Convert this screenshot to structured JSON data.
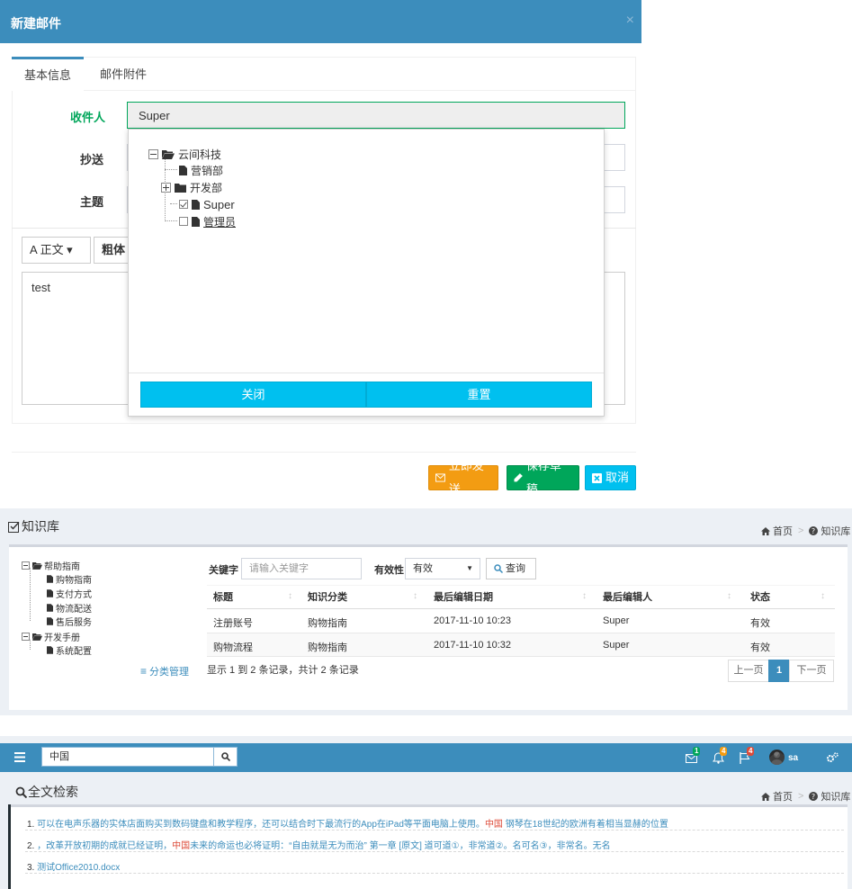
{
  "modal": {
    "title": "新建邮件",
    "close_symbol": "×",
    "tabs": [
      "基本信息",
      "邮件附件"
    ],
    "fields": {
      "to_label": "收件人",
      "to_value": "Super",
      "cc_label": "抄送",
      "subject_label": "主题"
    },
    "toolbar": {
      "format_label": "A 正文 ▾",
      "bold_label": "粗体"
    },
    "body_text": "test",
    "tree": {
      "root": "云间科技",
      "items": [
        "营销部",
        "开发部",
        "Super",
        "管理员"
      ]
    },
    "dropdown_buttons": {
      "close": "关闭",
      "reset": "重置"
    },
    "actions": {
      "send": "立即发送",
      "draft": "保存草稿",
      "cancel": "取消"
    },
    "colors": {
      "header": "#3c8dbc",
      "send": "#f39c12",
      "draft": "#00a65a",
      "cancel": "#00c0ef",
      "dropdown_btn": "#00c0ef"
    }
  },
  "knowledge": {
    "title": "知识库",
    "breadcrumb": {
      "home": "首页",
      "current": "知识库"
    },
    "tree": {
      "groups": [
        {
          "name": "帮助指南",
          "items": [
            "购物指南",
            "支付方式",
            "物流配送",
            "售后服务"
          ]
        },
        {
          "name": "开发手册",
          "items": [
            "系统配置"
          ]
        }
      ]
    },
    "category_manage": "分类管理",
    "filters": {
      "keyword_label": "关键字",
      "keyword_placeholder": "请输入关键字",
      "validity_label": "有效性",
      "validity_value": "有效",
      "query_button": "查询"
    },
    "table": {
      "columns": [
        "标题",
        "知识分类",
        "最后编辑日期",
        "最后编辑人",
        "状态"
      ],
      "rows": [
        [
          "注册账号",
          "购物指南",
          "2017-11-10 10:23",
          "Super",
          "有效"
        ],
        [
          "购物流程",
          "购物指南",
          "2017-11-10 10:32",
          "Super",
          "有效"
        ]
      ]
    },
    "summary": "显示 1 到 2 条记录，共计 2 条记录",
    "pager": {
      "prev": "上一页",
      "current": "1",
      "next": "下一页"
    }
  },
  "search": {
    "query": "中国",
    "nav": {
      "mail_badge": "1",
      "bell_badge": "4",
      "flag_badge": "4",
      "user": "sa"
    },
    "title": "全文检索",
    "breadcrumb": {
      "home": "首页",
      "current": "知识库"
    },
    "results": [
      {
        "num": "1.",
        "pre": "可以在电声乐器的实体店面购买到数码键盘和教学程序，还可以结合时下最流行的App在iPad等平面电脑上使用。",
        "hl": "中国",
        "post": " 钢琴在18世纪的欧洲有着相当显赫的位置"
      },
      {
        "num": "2.",
        "pre": "，改革开放初期的成就已经证明，",
        "hl": "中国",
        "post": "未来的命运也必将证明：“自由就是无为而治” 第一章 [原文] 道可道①，非常道②。名可名③，非常名。无名"
      },
      {
        "num": "3.",
        "pre": "测试Office2010.docx",
        "hl": "",
        "post": ""
      }
    ]
  }
}
